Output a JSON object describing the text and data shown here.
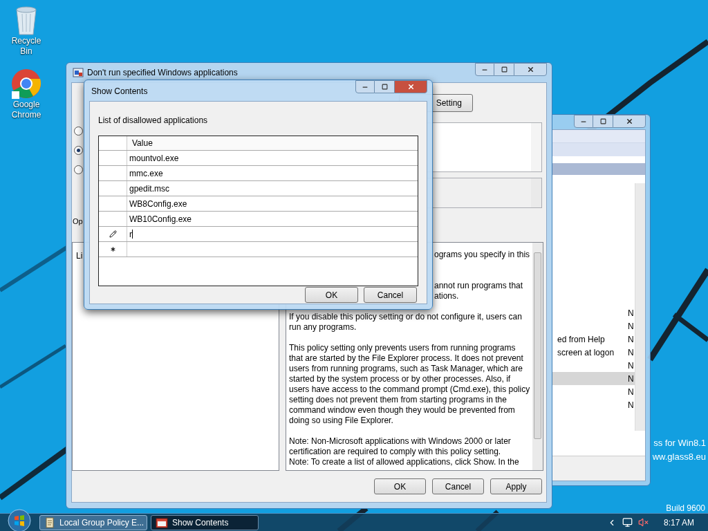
{
  "desktop": {
    "icons": [
      {
        "kind": "bin",
        "label": "Recycle Bin"
      },
      {
        "kind": "browser",
        "label": "Google Chrome"
      }
    ],
    "overlay_texts": [
      "ss for Win8.1",
      "ww.glass8.eu"
    ],
    "build": "Build 9600"
  },
  "editor_window": {
    "rows": [
      {
        "status": "N",
        "selected": false
      },
      {
        "status": "N",
        "selected": false
      },
      {
        "name": "ed from Help",
        "status": "N",
        "selected": false
      },
      {
        "name": "screen at logon",
        "status": "N",
        "selected": false
      },
      {
        "status": "N",
        "selected": false
      },
      {
        "status": "N",
        "selected": true
      },
      {
        "status": "N",
        "selected": false
      },
      {
        "status": "N",
        "selected": false
      }
    ]
  },
  "setting_dialog": {
    "title": "Don't run specified Windows applications",
    "next_button": "Setting",
    "radios": [
      {
        "selected": false
      },
      {
        "selected": true
      },
      {
        "selected": false
      }
    ],
    "options_label": "Op",
    "options_text": "Li",
    "help_fragments": [
      [
        "ograms you specify in this"
      ],
      [
        "annot run programs that",
        "ations."
      ]
    ],
    "help_paragraphs": [
      [
        "If you disable this policy setting or do not configure it, users can run any programs."
      ],
      [
        "This policy setting only prevents users from running programs that are started by the File Explorer process. It does not prevent users from running programs, such as Task Manager, which are started by the system process or by other processes.  Also, if users have access to the command prompt (Cmd.exe), this policy setting does not prevent them from starting programs in the command window even though they would be prevented from doing so using File Explorer."
      ],
      [
        "Note: Non-Microsoft applications with Windows 2000 or later certification are required to comply with this policy setting.",
        "Note: To create a list of allowed applications, click Show.  In the"
      ]
    ],
    "buttons": [
      "OK",
      "Cancel",
      "Apply"
    ]
  },
  "show_contents": {
    "title": "Show Contents",
    "label": "List of disallowed applications",
    "column": "Value",
    "rows": [
      {
        "kind": "row",
        "value": "mountvol.exe"
      },
      {
        "kind": "row",
        "value": "mmc.exe"
      },
      {
        "kind": "row",
        "value": "gpedit.msc"
      },
      {
        "kind": "row",
        "value": "WB8Config.exe"
      },
      {
        "kind": "row",
        "value": "WB10Config.exe"
      },
      {
        "kind": "editing",
        "value": "r"
      },
      {
        "kind": "new"
      }
    ],
    "buttons": [
      "OK",
      "Cancel"
    ]
  },
  "taskbar": {
    "tasks": [
      {
        "kind": "editor",
        "label": "Local Group Policy E...",
        "selected": false
      },
      {
        "kind": "list",
        "label": "Show Contents",
        "selected": true
      }
    ],
    "clock": "8:17 AM"
  }
}
